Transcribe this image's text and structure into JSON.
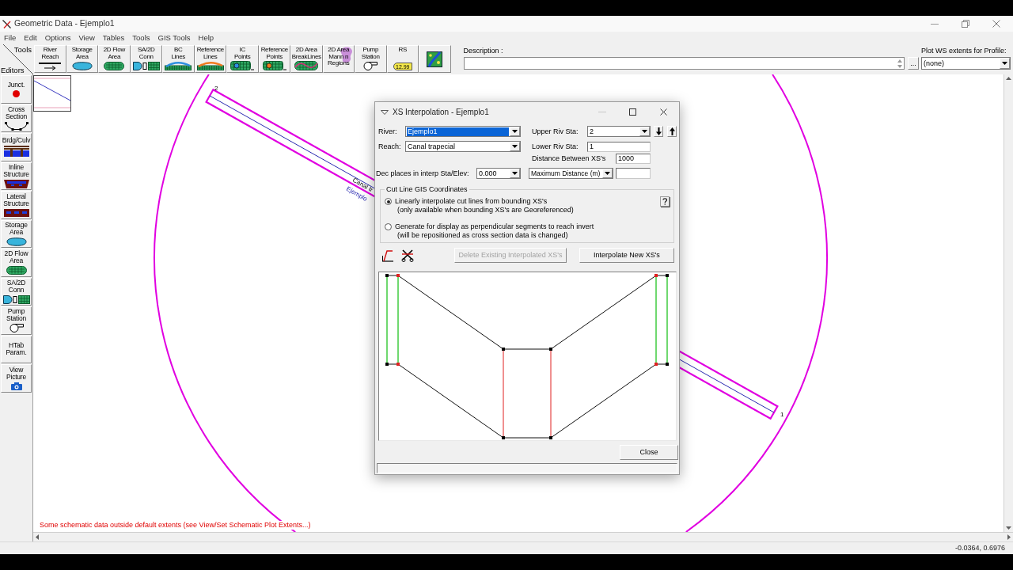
{
  "window": {
    "title": "Geometric Data - Ejemplo1"
  },
  "menu": [
    "File",
    "Edit",
    "Options",
    "View",
    "Tables",
    "Tools",
    "GIS Tools",
    "Help"
  ],
  "toolbar": {
    "tools_label": "Tools",
    "tools": [
      {
        "label": "River\nReach"
      },
      {
        "label": "Storage\nArea"
      },
      {
        "label": "2D Flow\nArea"
      },
      {
        "label": "SA/2D\nConn"
      },
      {
        "label": "BC\nLines"
      },
      {
        "label": "Reference\nLines"
      },
      {
        "label": "IC\nPoints"
      },
      {
        "label": "Reference\nPoints"
      },
      {
        "label": "2D Area\nBreakLines"
      },
      {
        "label": "2D Area\nMann n\nRegions"
      },
      {
        "label": "Pump\nStation"
      },
      {
        "label": "RS",
        "tag": "12.99"
      }
    ],
    "description": {
      "label": "Description :",
      "browse": "..."
    },
    "profile": {
      "label": "Plot WS extents for Profile:",
      "value": "(none)"
    }
  },
  "editors": {
    "label": "Editors",
    "items": [
      {
        "label": "Junct."
      },
      {
        "label": "Cross\nSection"
      },
      {
        "label": "Brdg/Culv"
      },
      {
        "label": "Inline\nStructure"
      },
      {
        "label": "Lateral\nStructure"
      },
      {
        "label": "Storage\nArea"
      },
      {
        "label": "2D Flow\nArea"
      },
      {
        "label": "SA/2D\nConn"
      },
      {
        "label": "Pump\nStation"
      },
      {
        "label": "HTab\nParam."
      },
      {
        "label": "View\nPicture"
      }
    ]
  },
  "canvas": {
    "station_labels": [
      "2",
      "1"
    ],
    "reach_label": "Canal tr",
    "river_label": "Ejemplo",
    "warning": "Some schematic data outside default extents (see View/Set Schematic Plot Extents...)"
  },
  "dialog": {
    "title": "XS Interpolation - Ejemplo1",
    "river": {
      "label": "River:",
      "value": "Ejemplo1",
      "highlighted": true
    },
    "upper_riv_sta": {
      "label": "Upper Riv Sta:",
      "value": "2"
    },
    "reach": {
      "label": "Reach:",
      "value": "Canal trapecial"
    },
    "lower_riv_sta": {
      "label": "Lower Riv Sta:",
      "value": "1"
    },
    "distance_between_xs": {
      "label": "Distance Between XS's",
      "value": "1000"
    },
    "dec_places": {
      "label": "Dec places in interp Sta/Elev:",
      "value": "0.000"
    },
    "max_distance_mode": {
      "value": "Maximum Distance (m)"
    },
    "cut_line_gis": {
      "title": "Cut Line GIS Coordinates",
      "options": [
        {
          "label": "Linearly interpolate cut lines from bounding XS's",
          "note": "(only available when bounding XS's are Georeferenced)",
          "selected": true
        },
        {
          "label": "Generate for display as perpendicular segments to reach invert",
          "note": "(will be repositioned as cross section data is changed)",
          "selected": false
        }
      ]
    },
    "actions": [
      {
        "label": "Delete Existing Interpolated XS's",
        "disabled": true
      },
      {
        "label": "Interpolate New XS's",
        "disabled": false
      }
    ],
    "close": "Close"
  },
  "status_bar": {
    "coordinates": "-0.0364, 0.6976"
  }
}
